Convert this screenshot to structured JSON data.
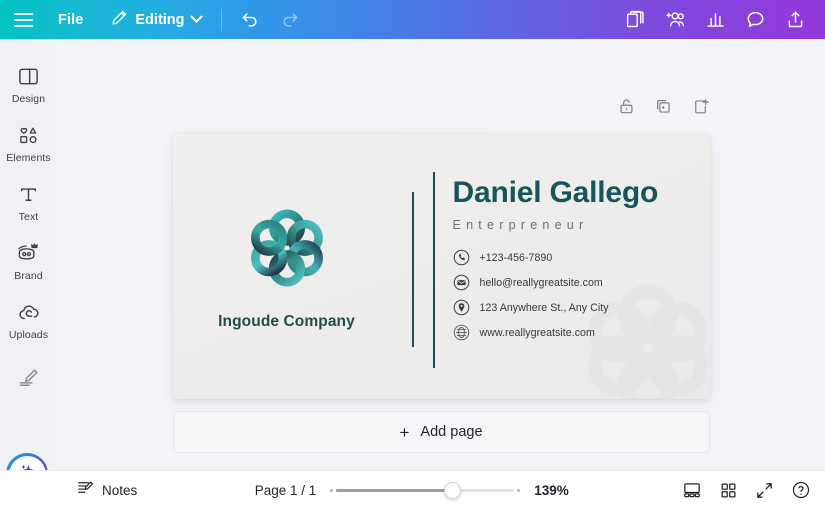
{
  "topbar": {
    "menu_icon": "hamburger-icon",
    "file_label": "File",
    "editing_label": "Editing",
    "editing_icon": "pencil-icon",
    "editing_chevron": "chevron-down-icon",
    "undo_icon": "undo-arrow-icon",
    "redo_icon": "redo-arrow-icon",
    "right_icons": [
      {
        "name": "duplicate-pages-icon",
        "label": "Duplicate"
      },
      {
        "name": "add-people-icon",
        "label": "Share with people"
      },
      {
        "name": "insights-chart-icon",
        "label": "Insights"
      },
      {
        "name": "comment-bubble-icon",
        "label": "Comments"
      },
      {
        "name": "share-upload-icon",
        "label": "Share"
      }
    ],
    "gradient_start": "#00c4bf",
    "gradient_end": "#9238da"
  },
  "sidebar": {
    "items": [
      {
        "label": "Design",
        "icon": "layout-panel-icon"
      },
      {
        "label": "Elements",
        "icon": "shapes-icon"
      },
      {
        "label": "Text",
        "icon": "text-T-icon"
      },
      {
        "label": "Brand",
        "icon": "brand-crown-icon"
      },
      {
        "label": "Uploads",
        "icon": "cloud-upload-icon"
      },
      {
        "label": "",
        "icon": "draw-pen-icon"
      }
    ],
    "magic_button": {
      "name": "magic-ai-button",
      "icon": "sparkle-icon"
    }
  },
  "page_tools": [
    {
      "name": "lock-page-icon",
      "label": "Lock"
    },
    {
      "name": "duplicate-page-icon",
      "label": "Duplicate page"
    },
    {
      "name": "add-page-icon",
      "label": "Add page"
    }
  ],
  "card": {
    "company_name": "Ingoude Company",
    "logo_icon": "celtic-knot-flower-logo",
    "watermark_icon": "celtic-knot-flower-watermark",
    "person_name": "Daniel Gallego",
    "role": "Enterpreneur",
    "contacts": [
      {
        "icon": "phone-icon",
        "text": "+123-456-7890"
      },
      {
        "icon": "email-icon",
        "text": "hello@reallygreatsite.com"
      },
      {
        "icon": "pin-icon",
        "text": "123 Anywhere St., Any City"
      },
      {
        "icon": "globe-icon",
        "text": "www.reallygreatsite.com"
      }
    ],
    "accent_color": "#17555c",
    "rule_color": "#1e4c52",
    "background_color": "#efeeec"
  },
  "add_page": {
    "plus": "+",
    "label": "Add page"
  },
  "bottombar": {
    "notes_label": "Notes",
    "notes_icon": "notes-icon",
    "page_indicator": "Page 1 / 1",
    "zoom_value": "139%",
    "right_icons": [
      {
        "name": "presenter-view-icon",
        "label": "Presenter view"
      },
      {
        "name": "grid-view-icon",
        "label": "Grid view"
      },
      {
        "name": "fullscreen-icon",
        "label": "Full screen"
      },
      {
        "name": "help-icon",
        "label": "Help"
      }
    ]
  }
}
